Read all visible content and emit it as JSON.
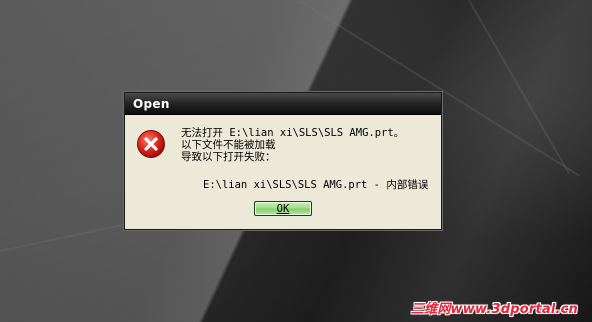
{
  "dialog": {
    "title": "Open",
    "icon": "error-icon",
    "message_lines": [
      "无法打开 E:\\lian xi\\SLS\\SLS AMG.prt。",
      "以下文件不能被加载",
      "导致以下打开失败："
    ],
    "detail": "E:\\lian xi\\SLS\\SLS AMG.prt - 内部错误",
    "ok_label": "OK"
  },
  "watermark": "三维网www.3dportal.cn",
  "colors": {
    "title_bar": "#1a1a1a",
    "dialog_bg": "#ece9d8",
    "error_red": "#d21b1b",
    "ok_button": "#a3de8d",
    "watermark": "#e8233a"
  }
}
